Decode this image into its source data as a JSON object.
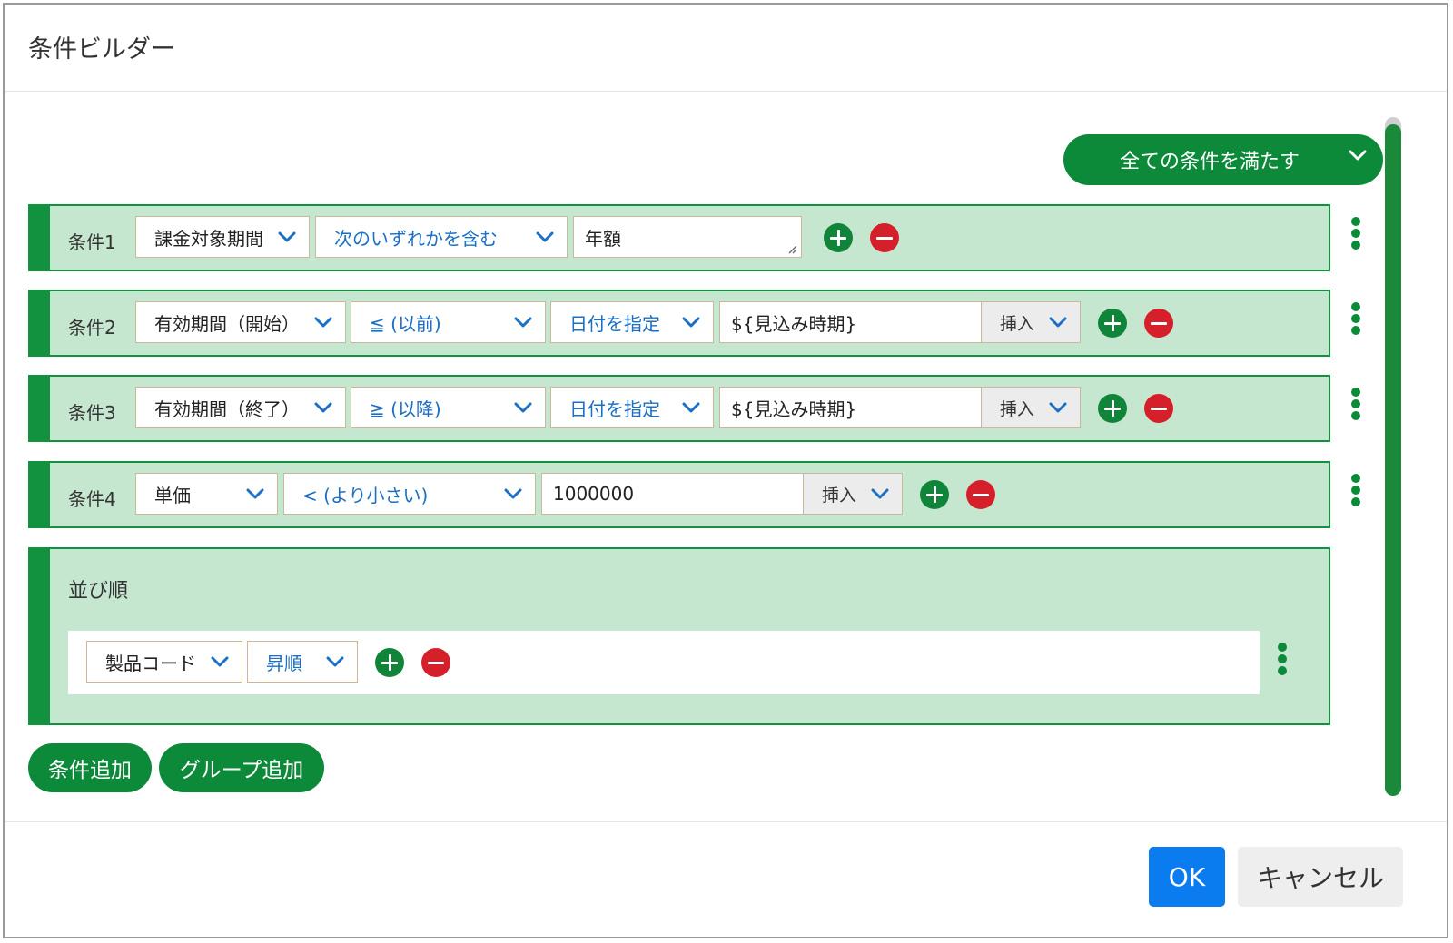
{
  "dialog": {
    "title": "条件ビルダー",
    "ok_label": "OK",
    "cancel_label": "キャンセル"
  },
  "match_mode": {
    "label": "全ての条件を満たす"
  },
  "conditions": [
    {
      "label": "条件1",
      "field": "課金対象期間",
      "operator": "次のいずれかを含む",
      "value": "年額"
    },
    {
      "label": "条件2",
      "field": "有効期間（開始）",
      "operator": "≦ (以前)",
      "value_type": "日付を指定",
      "value": "${見込み時期}",
      "insert_label": "挿入"
    },
    {
      "label": "条件3",
      "field": "有効期間（終了）",
      "operator": "≧ (以降)",
      "value_type": "日付を指定",
      "value": "${見込み時期}",
      "insert_label": "挿入"
    },
    {
      "label": "条件4",
      "field": "単価",
      "operator": "< (より小さい)",
      "value": "1000000",
      "insert_label": "挿入"
    }
  ],
  "sort": {
    "title": "並び順",
    "field": "製品コード",
    "order": "昇順"
  },
  "actions": {
    "add_condition": "条件追加",
    "add_group": "グループ追加"
  },
  "colors": {
    "accent_green": "#0c8a3a",
    "row_bg": "#c5e6cf",
    "remove_red": "#d51f2a",
    "ok_blue": "#0a7cf0",
    "link_blue": "#1b6fc4"
  }
}
